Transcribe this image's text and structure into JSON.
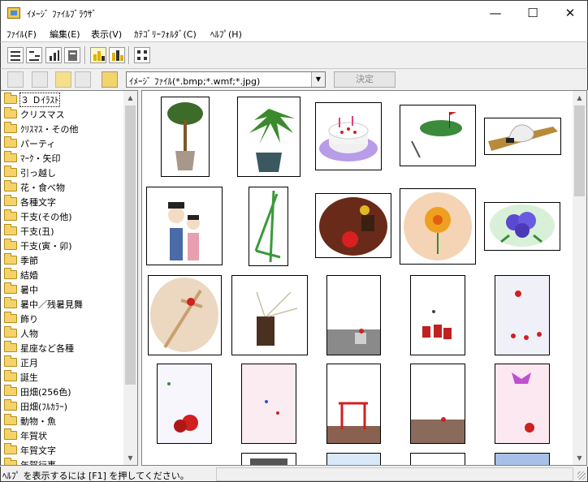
{
  "window": {
    "title": "ｲﾒｰｼﾞ ﾌｧｲﾙﾌﾞﾗｳｻﾞ",
    "minimize": "—",
    "maximize": "☐",
    "close": "✕"
  },
  "menu": [
    "ﾌｧｲﾙ(F)",
    "編集(E)",
    "表示(V)",
    "ｶﾃｺﾞﾘｰﾌｫﾙﾀﾞ(C)",
    "ﾍﾙﾌﾟ(H)"
  ],
  "filter": {
    "value": "ｲﾒｰｼﾞ ﾌｧｲﾙ(*.bmp;*.wmf;*.jpg)",
    "ok_label": "決定"
  },
  "categories": [
    "３ Ｄｲﾗｽﾄ",
    "クリスマス",
    "ｸﾘｽﾏｽ・その他",
    "パーティ",
    "ﾏｰｸ・矢印",
    "引っ越し",
    "花・食べ物",
    "各種文字",
    "干支(その他)",
    "干支(丑)",
    "干支(寅・卯)",
    "季節",
    "結婚",
    "暑中",
    "暑中／残暑見舞",
    "飾り",
    "人物",
    "星座など各種",
    "正月",
    "誕生",
    "田畑(256色)",
    "田畑(ﾌﾙｶﾗｰ)",
    "動物・魚",
    "年賀状",
    "年賀文字",
    "年賀行事"
  ],
  "status": "ﾍﾙﾌﾟ を表示するには [F1] を押してください。"
}
